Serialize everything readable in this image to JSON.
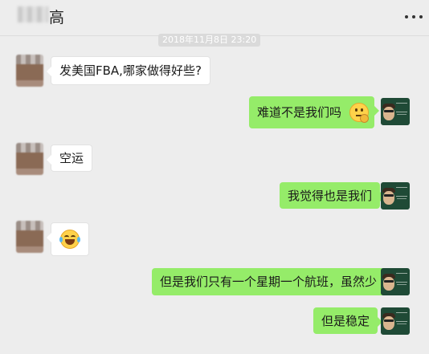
{
  "chat": {
    "title": "高",
    "timestamp": "2018年11月8日 23:20"
  },
  "messages": [
    {
      "side": "left",
      "text": "发美国FBA,哪家做得好些?"
    },
    {
      "side": "right",
      "text": "难道不是我们吗",
      "emoji": "thinking-face"
    },
    {
      "side": "left",
      "text": "空运"
    },
    {
      "side": "right",
      "text": "我觉得也是我们"
    },
    {
      "side": "left",
      "text": "",
      "emoji": "laughing-tears-face"
    },
    {
      "side": "right",
      "text": "但是我们只有一个星期一个航班，虽然少"
    },
    {
      "side": "right",
      "text": "但是稳定"
    }
  ],
  "colors": {
    "background": "#ededed",
    "sent_bubble": "#95ec69",
    "received_bubble": "#ffffff"
  }
}
